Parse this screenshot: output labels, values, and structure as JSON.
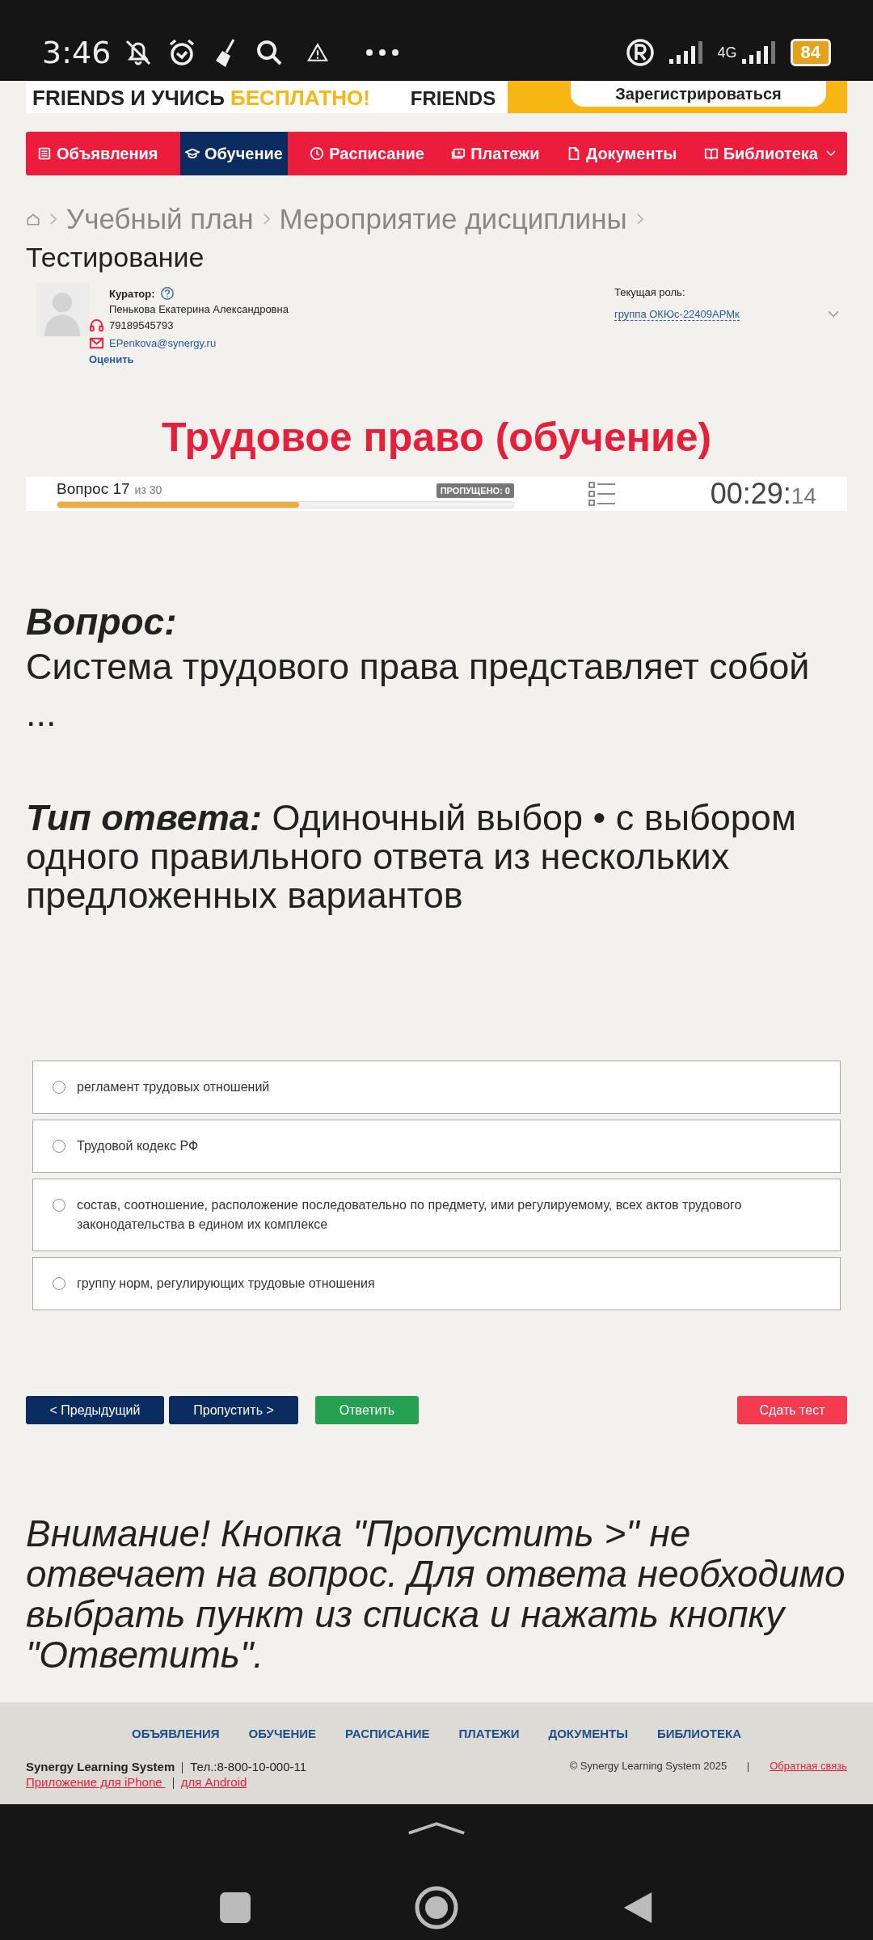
{
  "status_bar": {
    "time": "3:46",
    "network": "4G",
    "battery": "84"
  },
  "banner": {
    "line": "FRIENDS И УЧИСЬ ",
    "highlight": "БЕСПЛАТНО!",
    "logo": "FRIENDS",
    "button": "Зарегистрироваться"
  },
  "nav": [
    {
      "label": "Объявления",
      "selected": false
    },
    {
      "label": "Обучение",
      "selected": true
    },
    {
      "label": "Расписание",
      "selected": false
    },
    {
      "label": "Платежи",
      "selected": false
    },
    {
      "label": "Документы",
      "selected": false
    },
    {
      "label": "Библиотека",
      "selected": false,
      "dropdown": true
    }
  ],
  "breadcrumb": [
    "Учебный план",
    "Мероприятие дисциплины"
  ],
  "page_title": "Тестирование",
  "curator": {
    "label": "Куратор:",
    "name": "Пенькова Екатерина Александровна",
    "phone": "79189545793",
    "email": "EPenkova@synergy.ru",
    "rate": "Оценить"
  },
  "role": {
    "label": "Текущая роль:",
    "value": "группа ОКЮс-22409АРМк"
  },
  "course_title": "Трудовое право (обучение)",
  "progress": {
    "question": "Вопрос 17",
    "of": "из 30",
    "level": 0.53,
    "skipped": "ПРОПУЩЕНО: 0",
    "timer": "00:29:",
    "timer_seconds": "14"
  },
  "question": {
    "label": "Вопрос:",
    "text": "Система трудового права представляет собой ..."
  },
  "answer_type": {
    "label": "Тип ответа:",
    "text": "Одиночный выбор • с выбором одного правильного ответа из нескольких предложенных вариантов"
  },
  "answers": [
    {
      "text": "регламент трудовых отношений",
      "selected": false
    },
    {
      "text": "Трудовой кодекс РФ",
      "selected": false
    },
    {
      "text": "состав, соотношение, расположение последовательно по предмету, ими регулируемому, всех актов трудового законодательства в едином их комплексе",
      "selected": false
    },
    {
      "text": "группу норм, регулирующих трудовые отношения",
      "selected": false
    }
  ],
  "buttons": [
    {
      "label": "< Предыдущий",
      "kind": "nav"
    },
    {
      "label": "Пропустить >",
      "kind": "nav"
    },
    {
      "label": "Ответить",
      "kind": "answer"
    },
    {
      "label": "Сдать тест",
      "kind": "submit"
    }
  ],
  "warning": "Внимание! Кнопка \"Пропустить >\" не отвечает на вопрос. Для ответа необходимо выбрать пункт из списка и нажать кнопку \"Ответить\".",
  "footer": {
    "links": [
      "ОБЪЯВЛЕНИЯ",
      "ОБУЧЕНИЕ",
      "РАСПИСАНИЕ",
      "ПЛАТЕЖИ",
      "ДОКУМЕНТЫ",
      "БИБЛИОТЕКА"
    ],
    "brand": "Synergy Learning System",
    "phone": "Тел.:8-800-10-000-11",
    "iphone": "Приложение для iPhone ",
    "android": "для Android",
    "copyright": "© Synergy Learning System 2025",
    "feedback": "Обратная связь"
  }
}
